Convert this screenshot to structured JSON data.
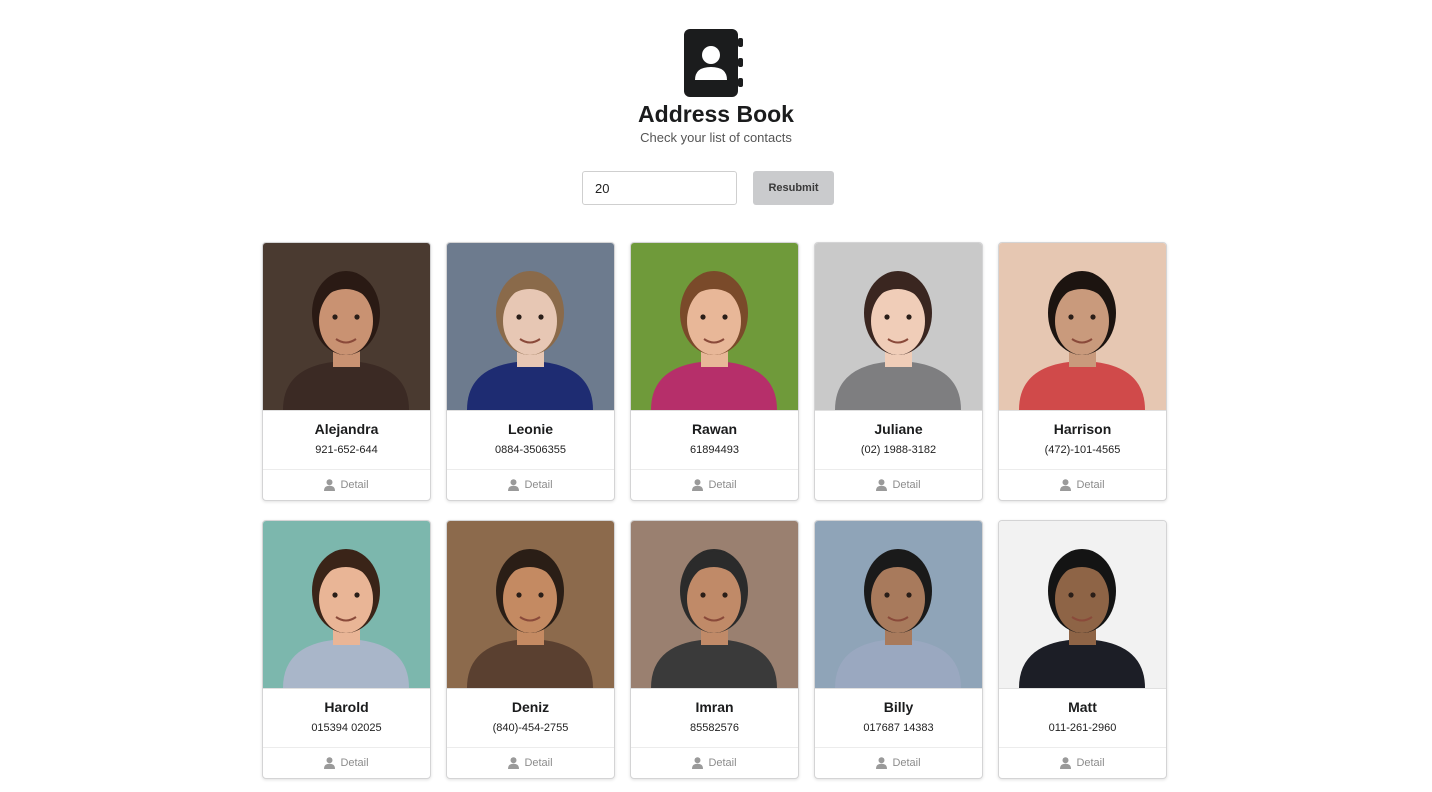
{
  "header": {
    "title": "Address Book",
    "subtitle": "Check your list of contacts",
    "icon": "address-book-icon"
  },
  "search": {
    "value": "20",
    "button_label": "Resubmit"
  },
  "detail_label": "Detail",
  "contacts": [
    {
      "name": "Alejandra",
      "phone": "921-652-644",
      "bg": "#4a3a30",
      "skin": "#c99272",
      "hair": "#2a1a14",
      "shirt": "#3b2a24"
    },
    {
      "name": "Leonie",
      "phone": "0884-3506355",
      "bg": "#6d7b8e",
      "skin": "#e7c7b4",
      "hair": "#8a6a4a",
      "shirt": "#1e2c72"
    },
    {
      "name": "Rawan",
      "phone": "61894493",
      "bg": "#6f9a3a",
      "skin": "#e8b798",
      "hair": "#7a4a2a",
      "shirt": "#b62f6a"
    },
    {
      "name": "Juliane",
      "phone": "(02) 1988-3182",
      "bg": "#c9c9c9",
      "skin": "#f0cdb8",
      "hair": "#3a2620",
      "shirt": "#7e7e80"
    },
    {
      "name": "Harrison",
      "phone": "(472)-101-4565",
      "bg": "#e6c7b2",
      "skin": "#c99a7c",
      "hair": "#1c1410",
      "shirt": "#d04a4a"
    },
    {
      "name": "Harold",
      "phone": "015394 02025",
      "bg": "#7cb7ad",
      "skin": "#e9b596",
      "hair": "#3a2418",
      "shirt": "#a9b6c9"
    },
    {
      "name": "Deniz",
      "phone": "(840)-454-2755",
      "bg": "#8c6a4c",
      "skin": "#c48a62",
      "hair": "#2a1e16",
      "shirt": "#5a4030"
    },
    {
      "name": "Imran",
      "phone": "85582576",
      "bg": "#9a8070",
      "skin": "#c08a68",
      "hair": "#2b2b2b",
      "shirt": "#3a3a3a"
    },
    {
      "name": "Billy",
      "phone": "017687 14383",
      "bg": "#8fa4b8",
      "skin": "#a87a5c",
      "hair": "#1a1a1a",
      "shirt": "#9aa8c0"
    },
    {
      "name": "Matt",
      "phone": "011-261-2960",
      "bg": "#f2f2f2",
      "skin": "#8e6446",
      "hair": "#141414",
      "shirt": "#1c1e26"
    }
  ]
}
